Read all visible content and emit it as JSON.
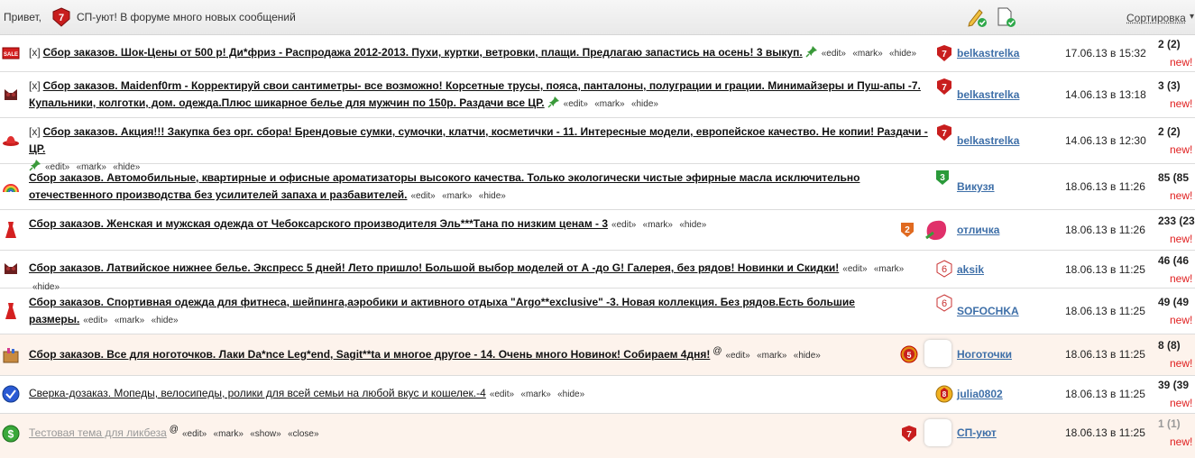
{
  "header": {
    "greeting": "Привет,",
    "message": "СП-уют! В форуме много новых сообщений",
    "sort_label": "Сортировка",
    "icons": [
      "edit-pencil-check-icon",
      "document-check-icon"
    ]
  },
  "controls": {
    "edit": "«edit»",
    "mark": "«mark»",
    "hide": "«hide»",
    "show": "«show»",
    "close": "«close»",
    "x": "[x]",
    "at": "@"
  },
  "topics": [
    {
      "icon": "sale-icon",
      "title": "Сбор заказов. Шок-Цены от 500 р! Ди*фриз - Распродажа 2012-2013. Пухи, куртки, ветровки, плащи. Предлагаю запастись на осень! 3 выкуп.",
      "author": "belkastrelka",
      "date": "17.06.13 в 15:32",
      "count": "2 (2)",
      "new": "new!"
    },
    {
      "icon": "lingerie-icon",
      "title": "Сбор заказов. Maidenf0rm - Корректируй свои сантиметры- все возможно! Корсетные трусы, пояса, панталоны, полуграции и грации. Минимайзеры и Пуш-апы -7. Купальники, колготки, дом. одежда.Плюс шикарное белье для мужчин по 150р. Раздачи все ЦР.",
      "author": "belkastrelka",
      "date": "14.06.13 в 13:18",
      "count": "3 (3)",
      "new": "new!"
    },
    {
      "icon": "hat-icon",
      "title": "Сбор заказов. Акция!!! Закупка без орг. сбора! Брендовые сумки, сумочки, клатчи, косметички - 11. Интересные модели, европейское качество. Не копии! Раздачи - ЦР.",
      "author": "belkastrelka",
      "date": "14.06.13 в 12:30",
      "count": "2 (2)",
      "new": "new!"
    },
    {
      "icon": "rainbow-icon",
      "title": "Сбор заказов. Автомобильные, квартирные и офисные ароматизаторы высокого качества. Только экологически чистые эфирные масла исключительно отечественного производства без усилителей запаха и разбавителей.",
      "author": "Викузя",
      "date": "18.06.13 в 11:26",
      "count": "85 (85",
      "new": "new!"
    },
    {
      "icon": "dress-icon",
      "title": "Сбор заказов. Женская и мужская одежда от Чебоксарского производителя Эль***Тана по низким ценам - 3",
      "author": "отличка",
      "date": "18.06.13 в 11:26",
      "count": "233 (23",
      "new": "new!"
    },
    {
      "icon": "lingerie-icon",
      "title": "Сбор заказов. Латвийское нижнее белье. Экспресс 5 дней! Лето пришло! Большой выбор моделей от А -до G! Галерея, без рядов! Новинки и Скидки!",
      "author": "aksik",
      "date": "18.06.13 в 11:25",
      "count": "46 (46",
      "new": "new!"
    },
    {
      "icon": "dress-icon",
      "title": "Сбор заказов. Спортивная одежда для фитнеса, шейпинга,аэробики и активного отдыха \"Argo**exclusive\" -3. Новая коллекция. Без рядов.Есть большие размеры.",
      "author": "SOFOCHKA",
      "date": "18.06.13 в 11:25",
      "count": "49 (49",
      "new": "new!"
    },
    {
      "icon": "nail-kit-icon",
      "title": "Сбор заказов. Все для ноготочков. Лаки Da*nce Leg*end, Sagit**ta и многое другое - 14. Очень много Новинок! Собираем 4дня!",
      "author": "Ноготочки",
      "date": "18.06.13 в 11:25",
      "count": "8 (8)",
      "new": "new!"
    },
    {
      "icon": "check-circle-icon",
      "title": "Сверка-дозаказ. Мопеды, велосипеды, ролики для всей семьи на любой вкус и кошелек.-4",
      "author": "julia0802",
      "date": "18.06.13 в 11:25",
      "count": "39 (39",
      "new": "new!"
    },
    {
      "icon": "dollar-icon",
      "title": "Тестовая тема для ликбеза",
      "author": "СП-уют",
      "date": "18.06.13 в 11:25",
      "count": "1 (1)",
      "new": "new!"
    }
  ],
  "colors": {
    "new": "#e02020",
    "author": "#3e6fa8",
    "pink_row": "#fdf3ec"
  }
}
